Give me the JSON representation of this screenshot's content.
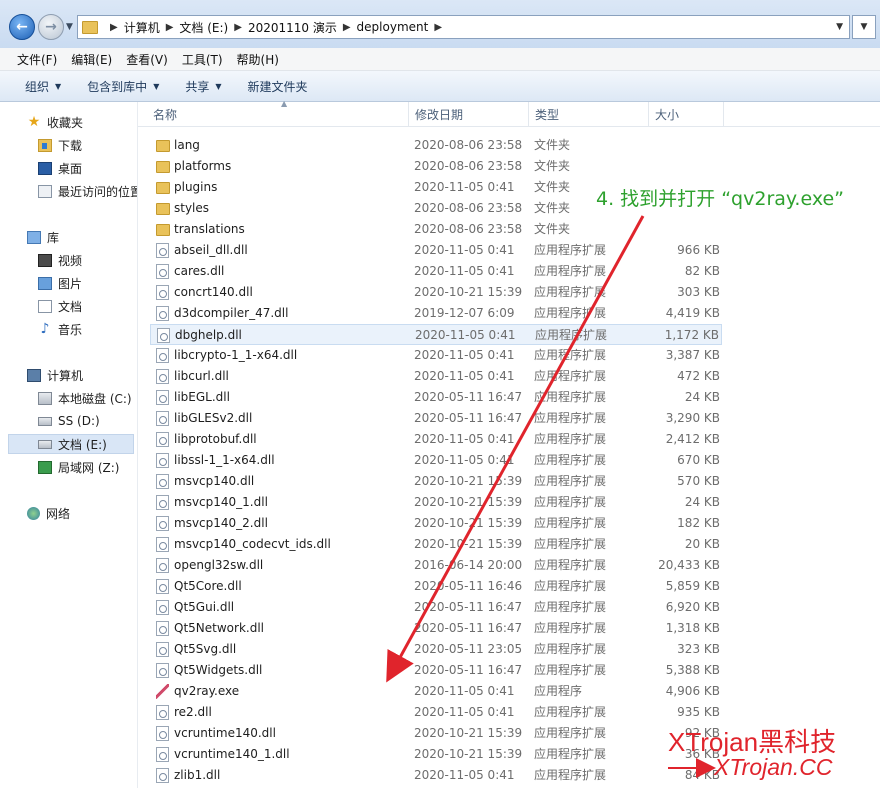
{
  "address_bar": {
    "crumbs": [
      "计算机",
      "文档 (E:)",
      "20201110 演示",
      "deployment"
    ]
  },
  "menubar": [
    "文件(F)",
    "编辑(E)",
    "查看(V)",
    "工具(T)",
    "帮助(H)"
  ],
  "toolbar": [
    {
      "label": "组织",
      "has_dropdown": true
    },
    {
      "label": "包含到库中",
      "has_dropdown": true
    },
    {
      "label": "共享",
      "has_dropdown": true
    },
    {
      "label": "新建文件夹",
      "has_dropdown": false
    }
  ],
  "nav_pane": {
    "favorites": {
      "label": "收藏夹",
      "items": [
        "下载",
        "桌面",
        "最近访问的位置"
      ]
    },
    "libraries": {
      "label": "库",
      "items": [
        "视频",
        "图片",
        "文档",
        "音乐"
      ]
    },
    "computer": {
      "label": "计算机",
      "items": [
        "本地磁盘 (C:)",
        "SS (D:)",
        "文档 (E:)",
        "局域网 (Z:)"
      ],
      "selected": "文档 (E:)"
    },
    "network": {
      "label": "网络"
    }
  },
  "columns": {
    "name": "名称",
    "date": "修改日期",
    "type": "类型",
    "size": "大小"
  },
  "files": [
    {
      "name": "lang",
      "date": "2020-08-06 23:58",
      "type": "文件夹",
      "size": "",
      "kind": "folder"
    },
    {
      "name": "platforms",
      "date": "2020-08-06 23:58",
      "type": "文件夹",
      "size": "",
      "kind": "folder"
    },
    {
      "name": "plugins",
      "date": "2020-11-05 0:41",
      "type": "文件夹",
      "size": "",
      "kind": "folder"
    },
    {
      "name": "styles",
      "date": "2020-08-06 23:58",
      "type": "文件夹",
      "size": "",
      "kind": "folder"
    },
    {
      "name": "translations",
      "date": "2020-08-06 23:58",
      "type": "文件夹",
      "size": "",
      "kind": "folder"
    },
    {
      "name": "abseil_dll.dll",
      "date": "2020-11-05 0:41",
      "type": "应用程序扩展",
      "size": "966 KB",
      "kind": "dll"
    },
    {
      "name": "cares.dll",
      "date": "2020-11-05 0:41",
      "type": "应用程序扩展",
      "size": "82 KB",
      "kind": "dll"
    },
    {
      "name": "concrt140.dll",
      "date": "2020-10-21 15:39",
      "type": "应用程序扩展",
      "size": "303 KB",
      "kind": "dll"
    },
    {
      "name": "d3dcompiler_47.dll",
      "date": "2019-12-07 6:09",
      "type": "应用程序扩展",
      "size": "4,419 KB",
      "kind": "dll"
    },
    {
      "name": "dbghelp.dll",
      "date": "2020-11-05 0:41",
      "type": "应用程序扩展",
      "size": "1,172 KB",
      "kind": "dll",
      "highlighted": true
    },
    {
      "name": "libcrypto-1_1-x64.dll",
      "date": "2020-11-05 0:41",
      "type": "应用程序扩展",
      "size": "3,387 KB",
      "kind": "dll"
    },
    {
      "name": "libcurl.dll",
      "date": "2020-11-05 0:41",
      "type": "应用程序扩展",
      "size": "472 KB",
      "kind": "dll"
    },
    {
      "name": "libEGL.dll",
      "date": "2020-05-11 16:47",
      "type": "应用程序扩展",
      "size": "24 KB",
      "kind": "dll"
    },
    {
      "name": "libGLESv2.dll",
      "date": "2020-05-11 16:47",
      "type": "应用程序扩展",
      "size": "3,290 KB",
      "kind": "dll"
    },
    {
      "name": "libprotobuf.dll",
      "date": "2020-11-05 0:41",
      "type": "应用程序扩展",
      "size": "2,412 KB",
      "kind": "dll"
    },
    {
      "name": "libssl-1_1-x64.dll",
      "date": "2020-11-05 0:41",
      "type": "应用程序扩展",
      "size": "670 KB",
      "kind": "dll"
    },
    {
      "name": "msvcp140.dll",
      "date": "2020-10-21 15:39",
      "type": "应用程序扩展",
      "size": "570 KB",
      "kind": "dll"
    },
    {
      "name": "msvcp140_1.dll",
      "date": "2020-10-21 15:39",
      "type": "应用程序扩展",
      "size": "24 KB",
      "kind": "dll"
    },
    {
      "name": "msvcp140_2.dll",
      "date": "2020-10-21 15:39",
      "type": "应用程序扩展",
      "size": "182 KB",
      "kind": "dll"
    },
    {
      "name": "msvcp140_codecvt_ids.dll",
      "date": "2020-10-21 15:39",
      "type": "应用程序扩展",
      "size": "20 KB",
      "kind": "dll"
    },
    {
      "name": "opengl32sw.dll",
      "date": "2016-06-14 20:00",
      "type": "应用程序扩展",
      "size": "20,433 KB",
      "kind": "dll"
    },
    {
      "name": "Qt5Core.dll",
      "date": "2020-05-11 16:46",
      "type": "应用程序扩展",
      "size": "5,859 KB",
      "kind": "dll"
    },
    {
      "name": "Qt5Gui.dll",
      "date": "2020-05-11 16:47",
      "type": "应用程序扩展",
      "size": "6,920 KB",
      "kind": "dll"
    },
    {
      "name": "Qt5Network.dll",
      "date": "2020-05-11 16:47",
      "type": "应用程序扩展",
      "size": "1,318 KB",
      "kind": "dll"
    },
    {
      "name": "Qt5Svg.dll",
      "date": "2020-05-11 23:05",
      "type": "应用程序扩展",
      "size": "323 KB",
      "kind": "dll"
    },
    {
      "name": "Qt5Widgets.dll",
      "date": "2020-05-11 16:47",
      "type": "应用程序扩展",
      "size": "5,388 KB",
      "kind": "dll"
    },
    {
      "name": "qv2ray.exe",
      "date": "2020-11-05 0:41",
      "type": "应用程序",
      "size": "4,906 KB",
      "kind": "exe"
    },
    {
      "name": "re2.dll",
      "date": "2020-11-05 0:41",
      "type": "应用程序扩展",
      "size": "935 KB",
      "kind": "dll"
    },
    {
      "name": "vcruntime140.dll",
      "date": "2020-10-21 15:39",
      "type": "应用程序扩展",
      "size": "92 KB",
      "kind": "dll"
    },
    {
      "name": "vcruntime140_1.dll",
      "date": "2020-10-21 15:39",
      "type": "应用程序扩展",
      "size": "36 KB",
      "kind": "dll"
    },
    {
      "name": "zlib1.dll",
      "date": "2020-11-05 0:41",
      "type": "应用程序扩展",
      "size": "84 KB",
      "kind": "dll"
    }
  ],
  "annotation": {
    "text": "4. 找到并打开 “qv2ray.exe”",
    "color": "#2ea12e",
    "arrow_color": "#e0242c"
  },
  "watermark": {
    "text": "XTrojan黑科技",
    "url": "XTrojan.CC",
    "color": "#e0242c"
  }
}
